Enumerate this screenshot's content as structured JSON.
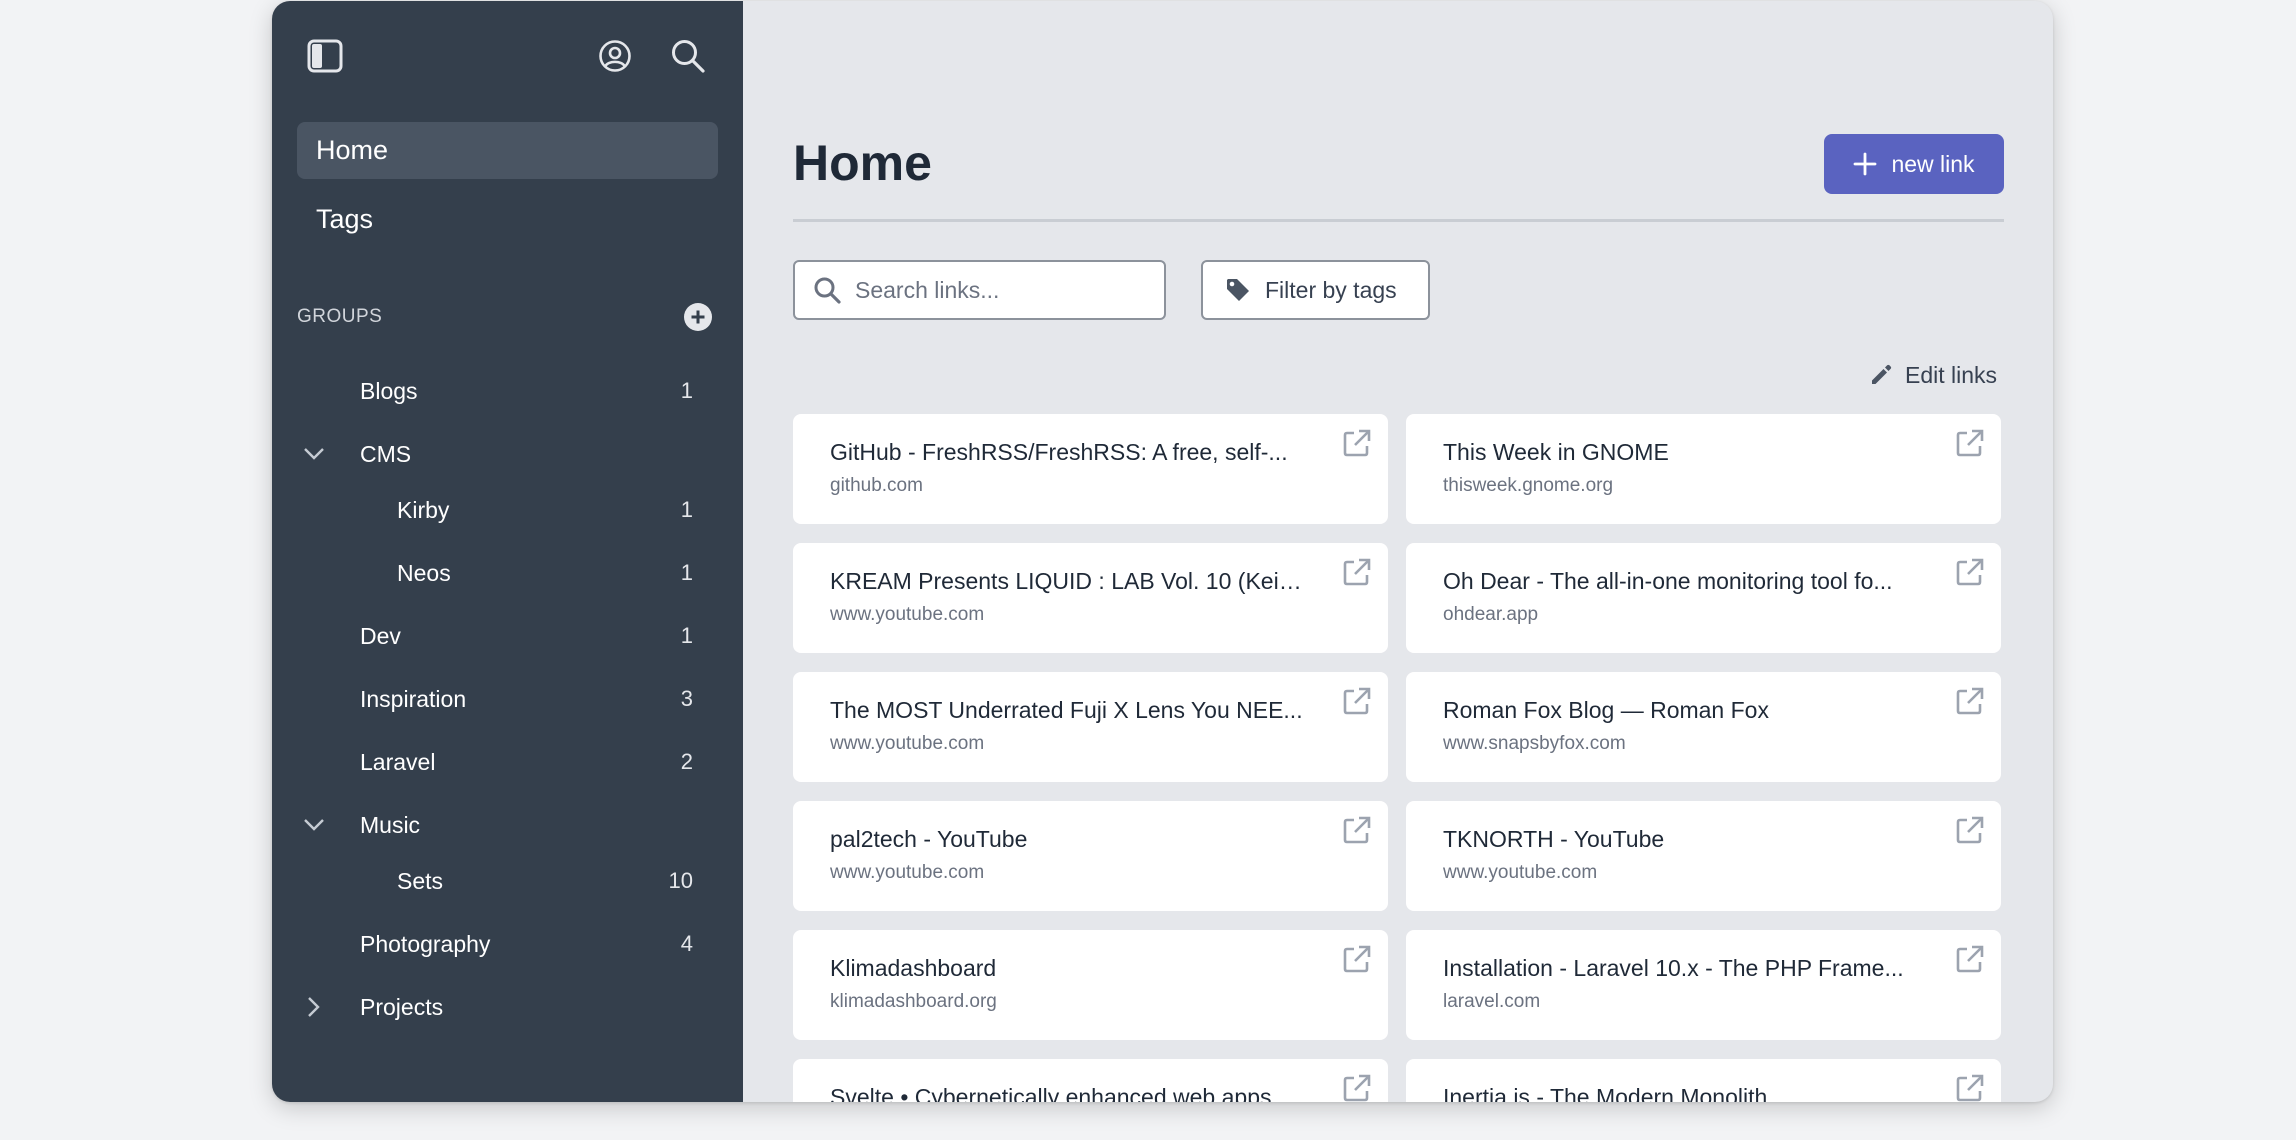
{
  "sidebar": {
    "nav": [
      {
        "label": "Home",
        "active": true
      },
      {
        "label": "Tags",
        "active": false
      }
    ],
    "groups_label": "GROUPS",
    "groups": [
      {
        "label": "Blogs",
        "count": "1",
        "level": 0,
        "chevron": ""
      },
      {
        "label": "CMS",
        "count": "",
        "level": 0,
        "chevron": "down"
      },
      {
        "label": "Kirby",
        "count": "1",
        "level": 1,
        "chevron": ""
      },
      {
        "label": "Neos",
        "count": "1",
        "level": 1,
        "chevron": ""
      },
      {
        "label": "Dev",
        "count": "1",
        "level": 0,
        "chevron": ""
      },
      {
        "label": "Inspiration",
        "count": "3",
        "level": 0,
        "chevron": ""
      },
      {
        "label": "Laravel",
        "count": "2",
        "level": 0,
        "chevron": ""
      },
      {
        "label": "Music",
        "count": "",
        "level": 0,
        "chevron": "down"
      },
      {
        "label": "Sets",
        "count": "10",
        "level": 1,
        "chevron": ""
      },
      {
        "label": "Photography",
        "count": "4",
        "level": 0,
        "chevron": ""
      },
      {
        "label": "Projects",
        "count": "",
        "level": 0,
        "chevron": "right"
      }
    ],
    "icons": {
      "toggle": "sidebar-toggle-icon",
      "user": "user-circle-icon",
      "search": "search-icon",
      "add": "plus-circle-icon"
    }
  },
  "main": {
    "title": "Home",
    "new_link_label": "new link",
    "search_placeholder": "Search links...",
    "filter_label": "Filter by tags",
    "edit_label": "Edit links",
    "links": [
      {
        "title": "GitHub - FreshRSS/FreshRSS: A free, self-...",
        "domain": "github.com"
      },
      {
        "title": "This Week in GNOME",
        "domain": "thisweek.gnome.org"
      },
      {
        "title": "KREAM Presents LIQUID : LAB Vol. 10 (Kein...",
        "domain": "www.youtube.com"
      },
      {
        "title": "Oh Dear - The all-in-one monitoring tool fo...",
        "domain": "ohdear.app"
      },
      {
        "title": "The MOST Underrated Fuji X Lens You NEE...",
        "domain": "www.youtube.com"
      },
      {
        "title": "Roman Fox Blog — Roman Fox",
        "domain": "www.snapsbyfox.com"
      },
      {
        "title": "pal2tech - YouTube",
        "domain": "www.youtube.com"
      },
      {
        "title": "TKNORTH - YouTube",
        "domain": "www.youtube.com"
      },
      {
        "title": "Klimadashboard",
        "domain": "klimadashboard.org"
      },
      {
        "title": "Installation - Laravel 10.x - The PHP Frame...",
        "domain": "laravel.com"
      },
      {
        "title": "Svelte • Cybernetically enhanced web apps",
        "domain": ""
      },
      {
        "title": "Inertia.js - The Modern Monolith",
        "domain": ""
      }
    ]
  },
  "colors": {
    "sidebar_bg": "#343f4c",
    "main_bg": "#e5e7eb",
    "accent": "#5a63c0",
    "active_nav": "#4a5563"
  }
}
